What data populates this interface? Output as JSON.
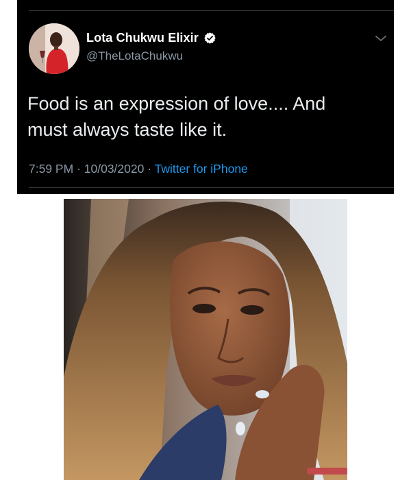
{
  "tweet": {
    "display_name": "Lota Chukwu Elixir",
    "handle": "@TheLotaChukwu",
    "text": "Food is an expression of love.... And\nmust always taste like it.",
    "time": "7:59 PM",
    "separator": "·",
    "date": "10/03/2020",
    "source": "Twitter for iPhone",
    "verified_icon": "verified-badge-icon",
    "more_icon": "chevron-down-icon",
    "colors": {
      "background": "#000000",
      "secondary_text": "#8b98a5",
      "link": "#1d9bf0"
    }
  },
  "photo": {
    "subject": "selfie of a woman with long honey-blonde hair resting her chin on her hand"
  }
}
